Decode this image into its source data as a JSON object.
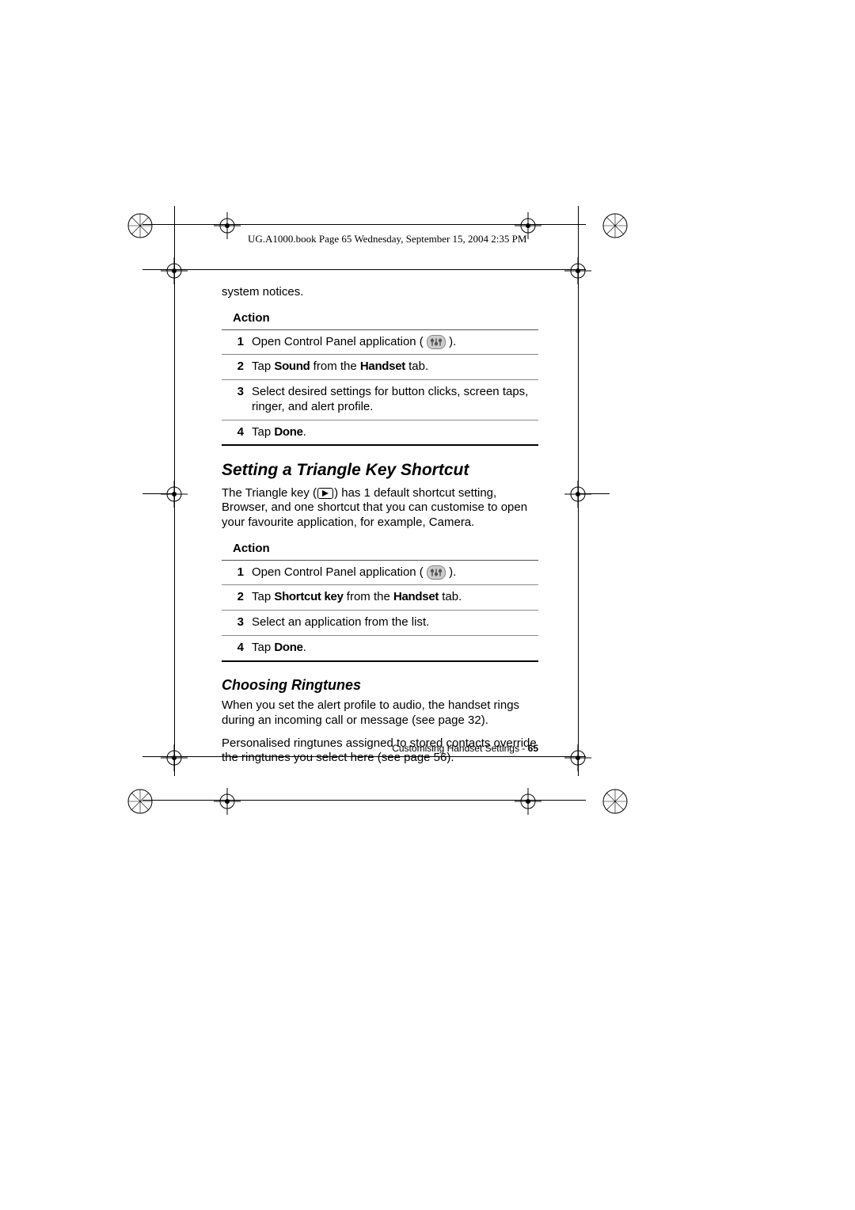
{
  "header": "UG.A1000.book  Page 65  Wednesday, September 15, 2004  2:35 PM",
  "intro_fragment": "system notices.",
  "action_label": "Action",
  "table1": {
    "rows": [
      {
        "num": "1",
        "pre": "Open Control Panel application (",
        "post": ")."
      },
      {
        "num": "2",
        "pre": "Tap ",
        "b1": "Sound",
        "mid": " from the ",
        "b2": "Handset",
        "post": " tab."
      },
      {
        "num": "3",
        "text": "Select desired settings for button clicks, screen taps, ringer, and alert profile."
      },
      {
        "num": "4",
        "pre": "Tap ",
        "b1": "Done",
        "post": "."
      }
    ]
  },
  "section1": {
    "title": "Setting a Triangle Key Shortcut",
    "para_pre": "The Triangle key (",
    "para_post": ") has 1 default shortcut setting, Browser, and one shortcut that you can customise to open your favourite application, for example, Camera."
  },
  "table2": {
    "rows": [
      {
        "num": "1",
        "pre": "Open Control Panel application (",
        "post": ")."
      },
      {
        "num": "2",
        "pre": "Tap ",
        "b1": "Shortcut key",
        "mid": " from the ",
        "b2": "Handset",
        "post": " tab."
      },
      {
        "num": "3",
        "text": "Select an application from the list."
      },
      {
        "num": "4",
        "pre": "Tap ",
        "b1": "Done",
        "post": "."
      }
    ]
  },
  "section2": {
    "title": "Choosing Ringtunes",
    "p1": "When you set the alert profile to audio, the handset rings during an incoming call or message (see page 32).",
    "p2": "Personalised ringtunes assigned to stored contacts override the ringtunes you select here (see page 56)."
  },
  "footer": {
    "label": "Customising Handset Settings - ",
    "page": "65"
  }
}
